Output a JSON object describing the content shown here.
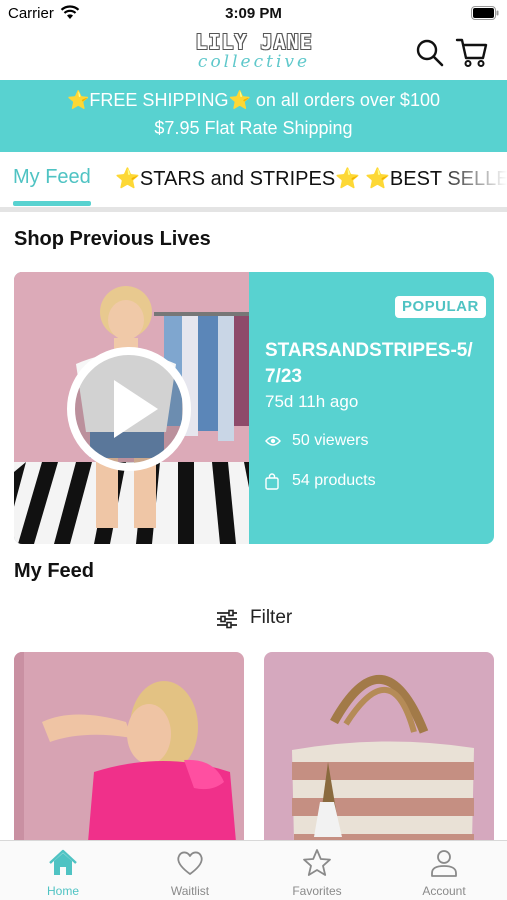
{
  "status_bar": {
    "carrier": "Carrier",
    "time": "3:09 PM"
  },
  "header": {
    "logo_top": "LILY JANE",
    "logo_bottom": "collective"
  },
  "banner": {
    "line1": "⭐FREE SHIPPING⭐ on all orders over $100",
    "line2": "$7.95 Flat Rate Shipping"
  },
  "tabs": [
    {
      "label": "My Feed",
      "active": true
    },
    {
      "label": "⭐STARS and STRIPES⭐",
      "active": false
    },
    {
      "label": "⭐BEST SELLERS",
      "active": false
    }
  ],
  "sections": {
    "previous_lives": "Shop Previous Lives",
    "my_feed": "My Feed"
  },
  "live": {
    "badge": "POPULAR",
    "title": "STARSANDSTRIPES-5/7/23",
    "time_ago": "75d 11h ago",
    "viewers": "50 viewers",
    "products": "54 products"
  },
  "filter": {
    "label": "Filter"
  },
  "bottom_nav": [
    {
      "label": "Home",
      "icon": "home-icon",
      "active": true
    },
    {
      "label": "Waitlist",
      "icon": "heart-icon",
      "active": false
    },
    {
      "label": "Favorites",
      "icon": "star-icon",
      "active": false
    },
    {
      "label": "Account",
      "icon": "person-icon",
      "active": false
    }
  ],
  "colors": {
    "accent": "#58d2d0",
    "accent_text": "#4fc3c3",
    "nav_inactive": "#8a8a8a"
  }
}
